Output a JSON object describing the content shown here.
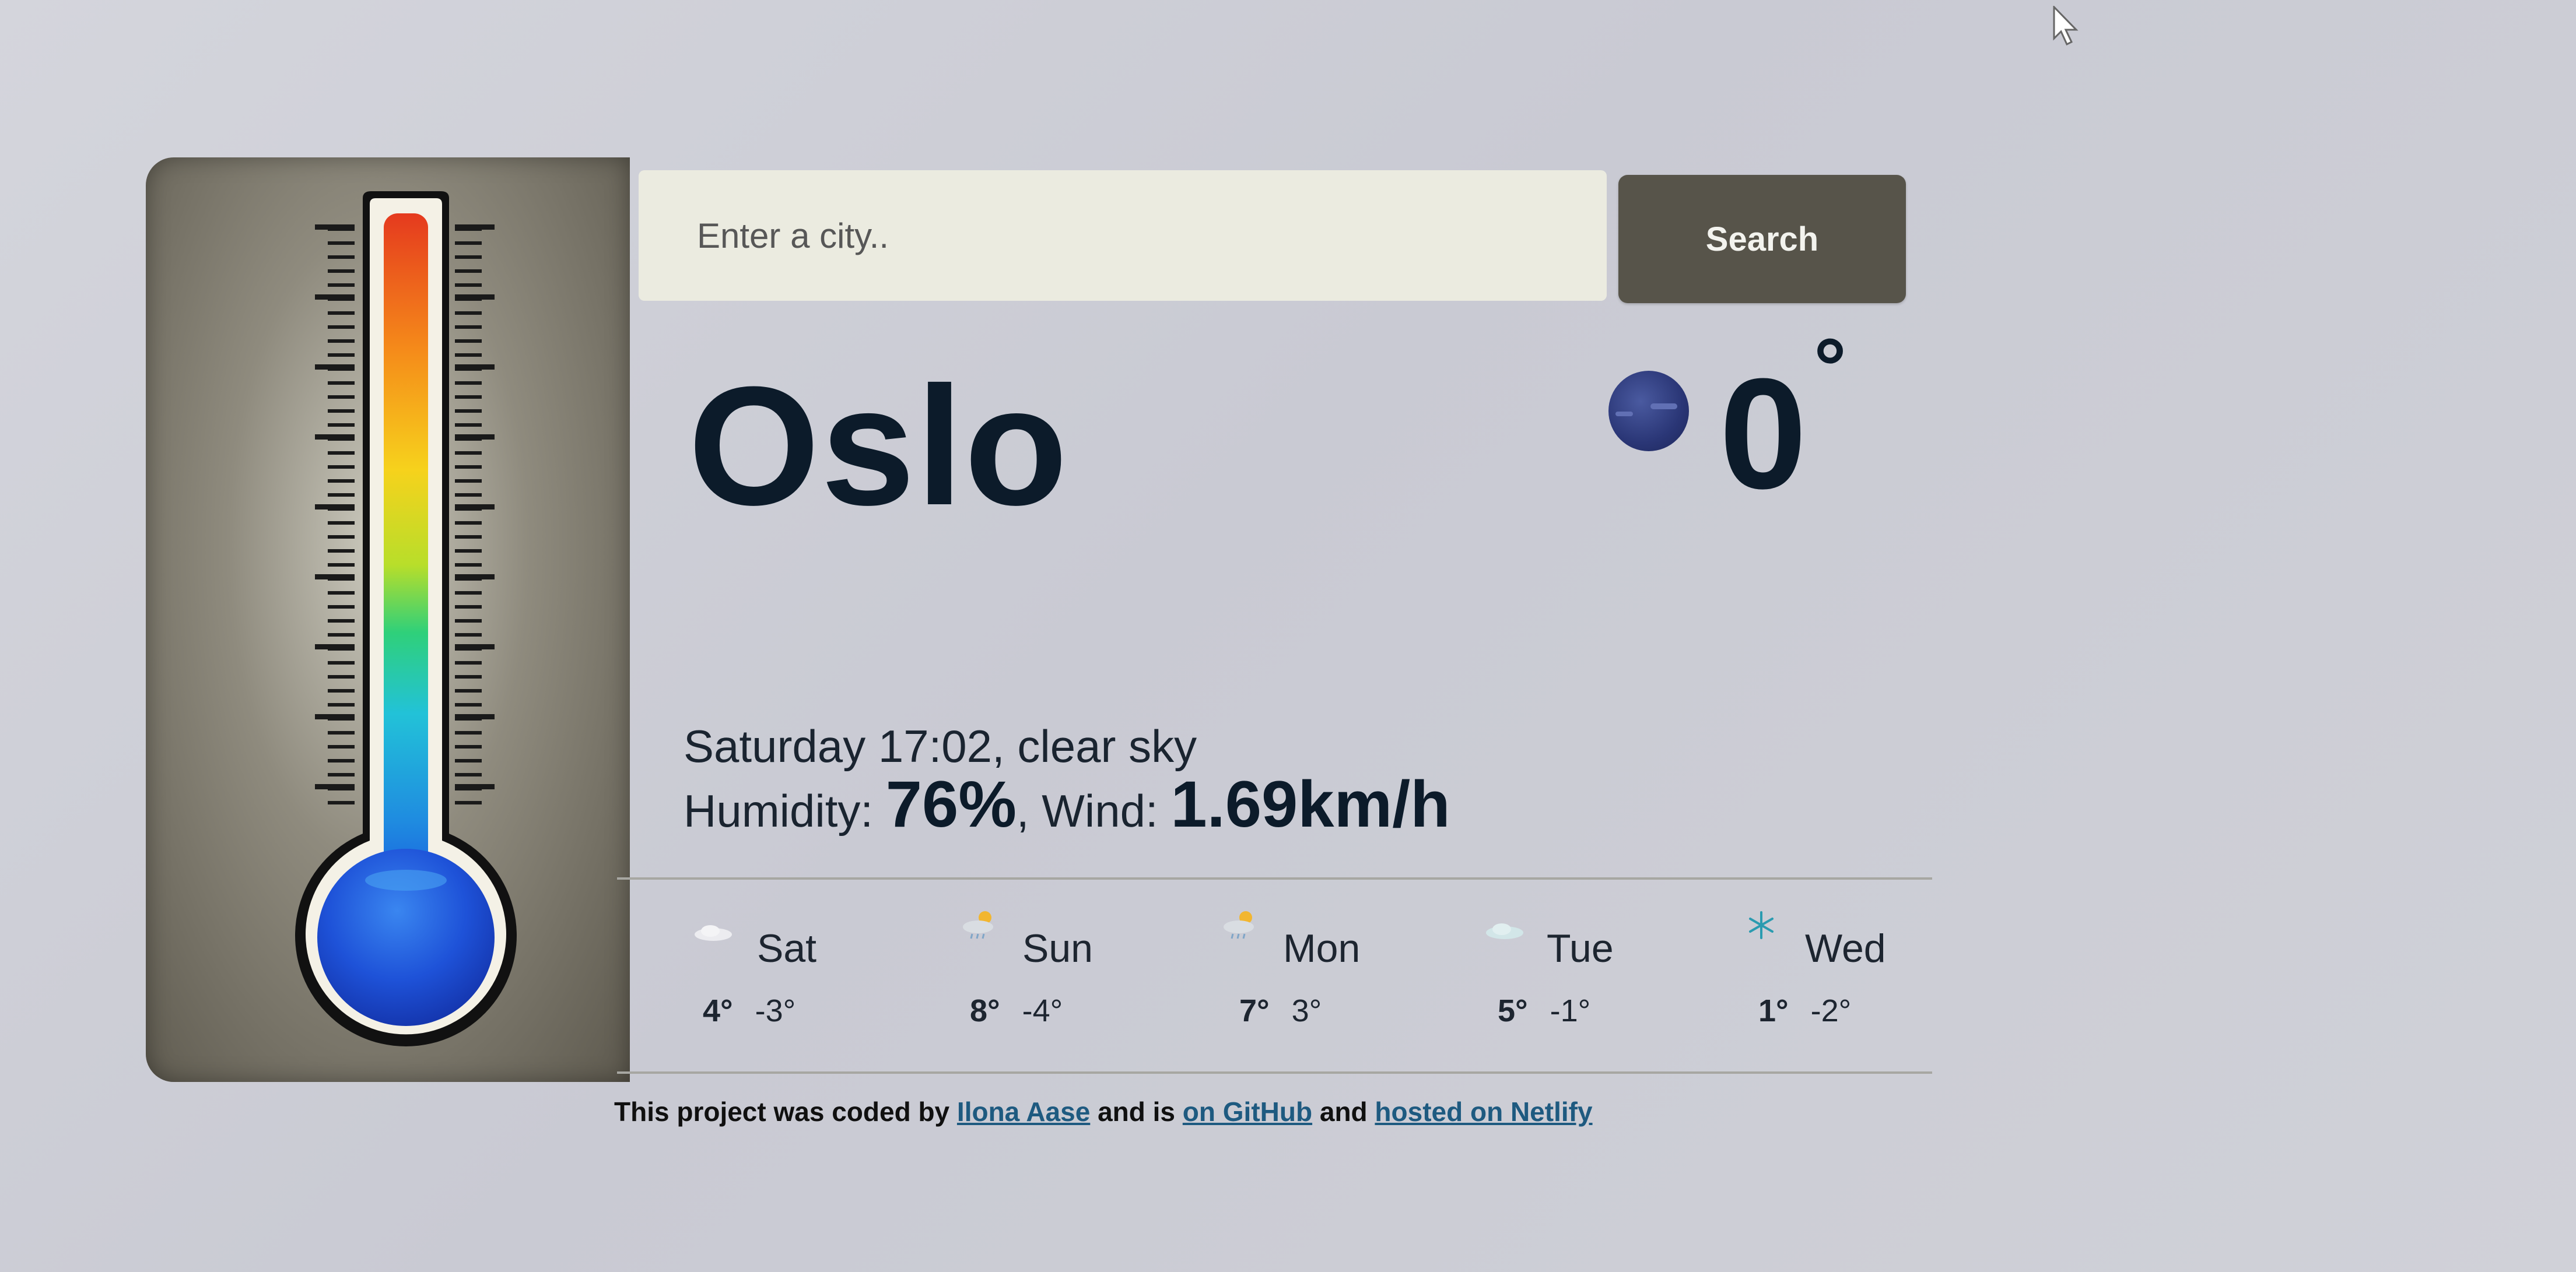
{
  "search": {
    "placeholder": "Enter a city..",
    "button_label": "Search"
  },
  "current": {
    "city": "Oslo",
    "icon": "moon-icon",
    "temperature": "0",
    "degree": "°",
    "date_desc": "Saturday 17:02, clear sky",
    "humidity_label": "Humidity: ",
    "humidity_value": "76%",
    "wind_label": ", Wind: ",
    "wind_value": "1.69km/h"
  },
  "forecast": [
    {
      "day": "Sat",
      "icon": "cloud-icon",
      "max": "4°",
      "min": "-3°"
    },
    {
      "day": "Sun",
      "icon": "sun-rain-cloud-icon",
      "max": "8°",
      "min": "-4°"
    },
    {
      "day": "Mon",
      "icon": "sun-rain-cloud-icon",
      "max": "7°",
      "min": "3°"
    },
    {
      "day": "Tue",
      "icon": "cloud-icon",
      "max": "5°",
      "min": "-1°"
    },
    {
      "day": "Wed",
      "icon": "snowflake-icon",
      "max": "1°",
      "min": "-2°"
    }
  ],
  "footer": {
    "prefix": "This project was coded by ",
    "author_link": "Ilona Aase",
    "middle": " and is ",
    "github_link": "on GitHub",
    "and": " and ",
    "netlify_link": "hosted on Netlify"
  },
  "colors": {
    "button": "#57544a",
    "text_dark": "#0c1b2a",
    "link": "#1e5a80",
    "input_bg": "#ebebe0"
  }
}
